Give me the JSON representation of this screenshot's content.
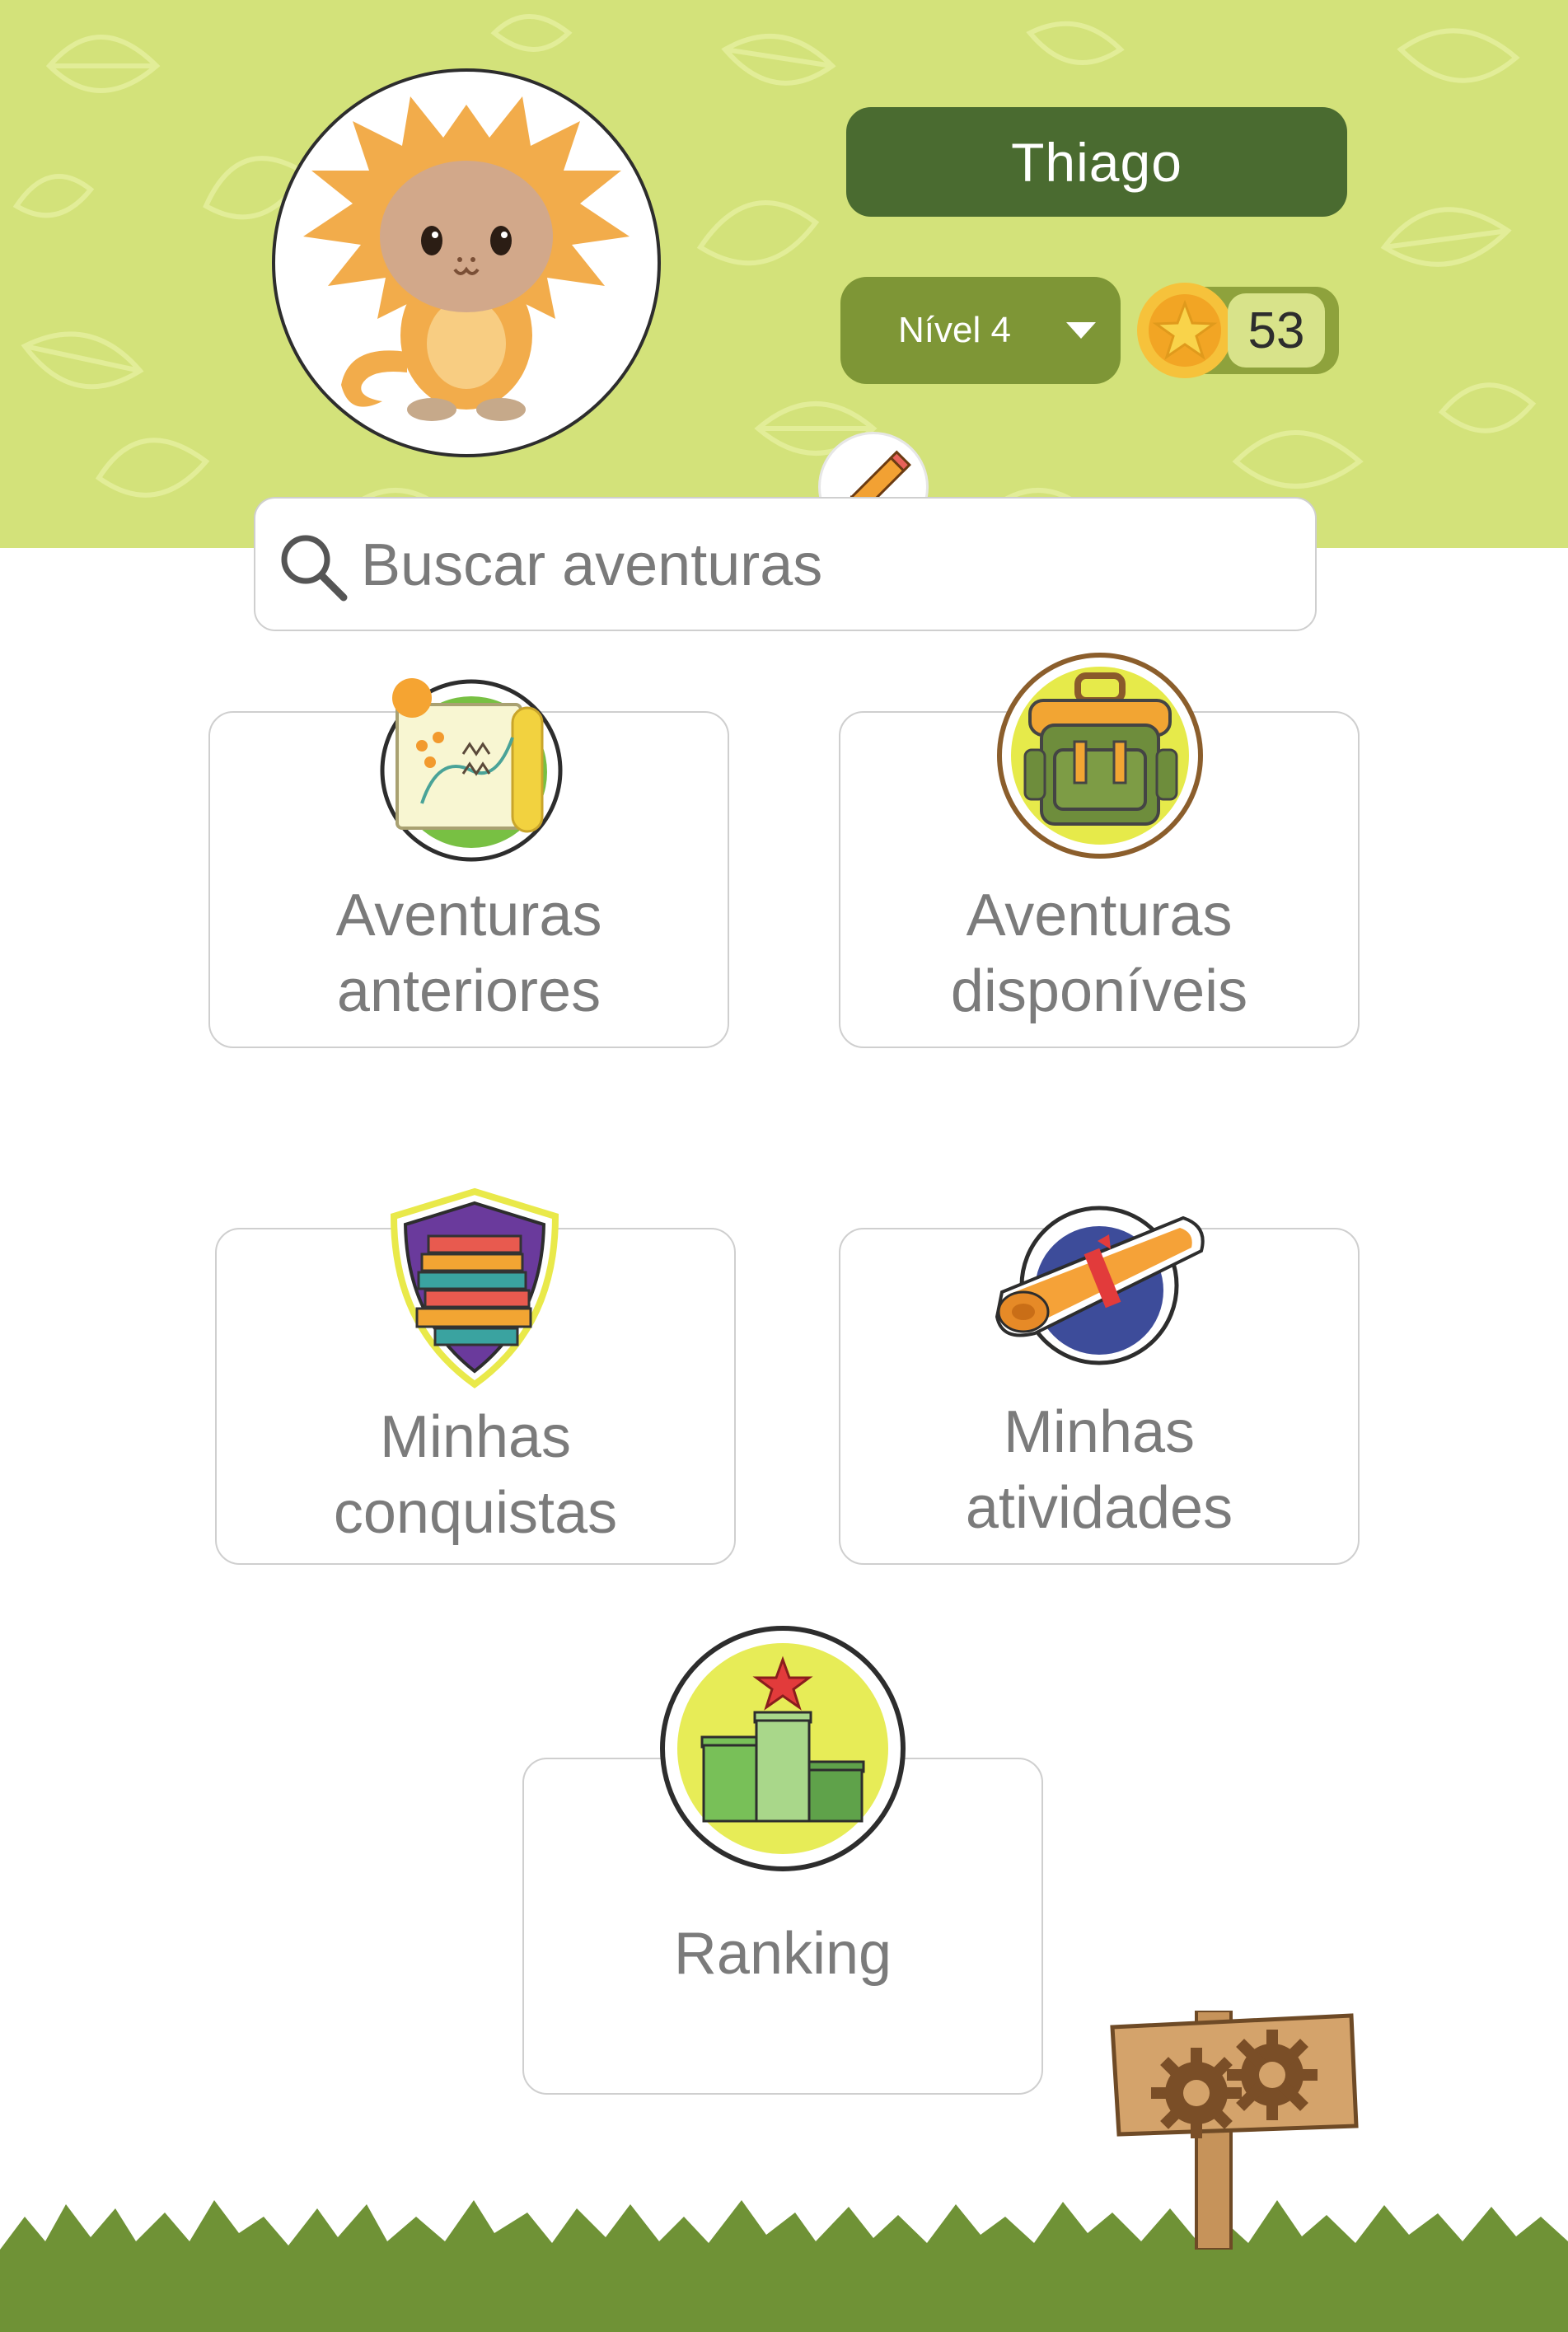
{
  "profile": {
    "name": "Thiago",
    "level": "Nível 4",
    "coins": "53"
  },
  "search": {
    "placeholder": "Buscar aventuras"
  },
  "menu": {
    "past_adventures": [
      "Aventuras",
      "anteriores"
    ],
    "available_adventures": [
      "Aventuras",
      "disponíveis"
    ],
    "achievements": [
      "Minhas",
      "conquistas"
    ],
    "activities": [
      "Minhas",
      "atividades"
    ],
    "ranking": [
      "Ranking"
    ]
  },
  "icons": {
    "avatar": "monkey-mascot-icon",
    "edit": "pencil-icon",
    "coin": "star-coin-icon",
    "search": "search-icon",
    "past_adventures": "map-icon",
    "available_adventures": "backpack-icon",
    "achievements": "books-shield-icon",
    "activities": "scroll-icon",
    "ranking": "podium-icon",
    "settings": "gears-signpost-icon"
  },
  "colors": {
    "header_bg": "#d3e27a",
    "name_pill": "#4a6b30",
    "level_pill": "#7e9636",
    "grass": "#6f9236"
  }
}
